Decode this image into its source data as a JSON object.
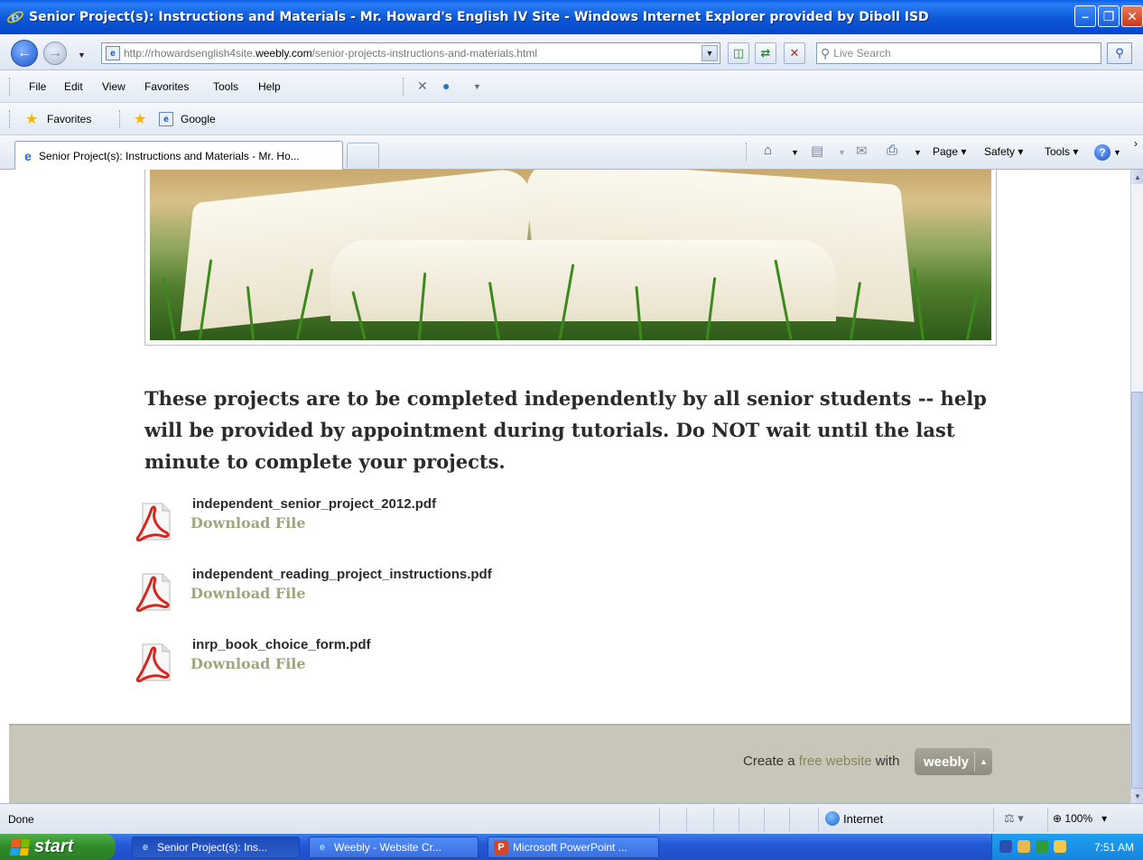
{
  "window": {
    "title": "Senior Project(s): Instructions and Materials - Mr. Howard's English IV Site - Windows Internet Explorer provided by Diboll ISD"
  },
  "address": {
    "url_prefix": "http://rhowardsenglish4site.",
    "url_domain": "weebly.com",
    "url_path": "/senior-projects-instructions-and-materials.html"
  },
  "search": {
    "placeholder": "Live Search"
  },
  "menu": {
    "items": [
      "File",
      "Edit",
      "View",
      "Favorites",
      "Tools",
      "Help"
    ]
  },
  "favorites": {
    "label": "Favorites",
    "google": "Google"
  },
  "tabs": {
    "active_label": "Senior Project(s): Instructions and Materials - Mr. Ho..."
  },
  "commandbar": {
    "page": "Page",
    "safety": "Safety",
    "tools": "Tools"
  },
  "content": {
    "intro": "These projects are to be completed independently by all senior students -- help will be provided by appointment during tutorials. Do NOT wait until the last minute to complete your projects.",
    "files": [
      {
        "name": "independent_senior_project_2012.pdf",
        "link": "Download File"
      },
      {
        "name": "independent_reading_project_instructions.pdf",
        "link": "Download File"
      },
      {
        "name": "inrp_book_choice_form.pdf",
        "link": "Download File"
      }
    ]
  },
  "footer": {
    "create": "Create a",
    "free": "free website",
    "with": "with",
    "brand": "weebly"
  },
  "status": {
    "text": "Done",
    "zone": "Internet",
    "zoom": "100%"
  },
  "taskbar": {
    "start": "start",
    "tasks": [
      "Senior Project(s): Ins...",
      "Weebly - Website Cr...",
      "Microsoft PowerPoint ..."
    ],
    "clock": "7:51 AM"
  }
}
